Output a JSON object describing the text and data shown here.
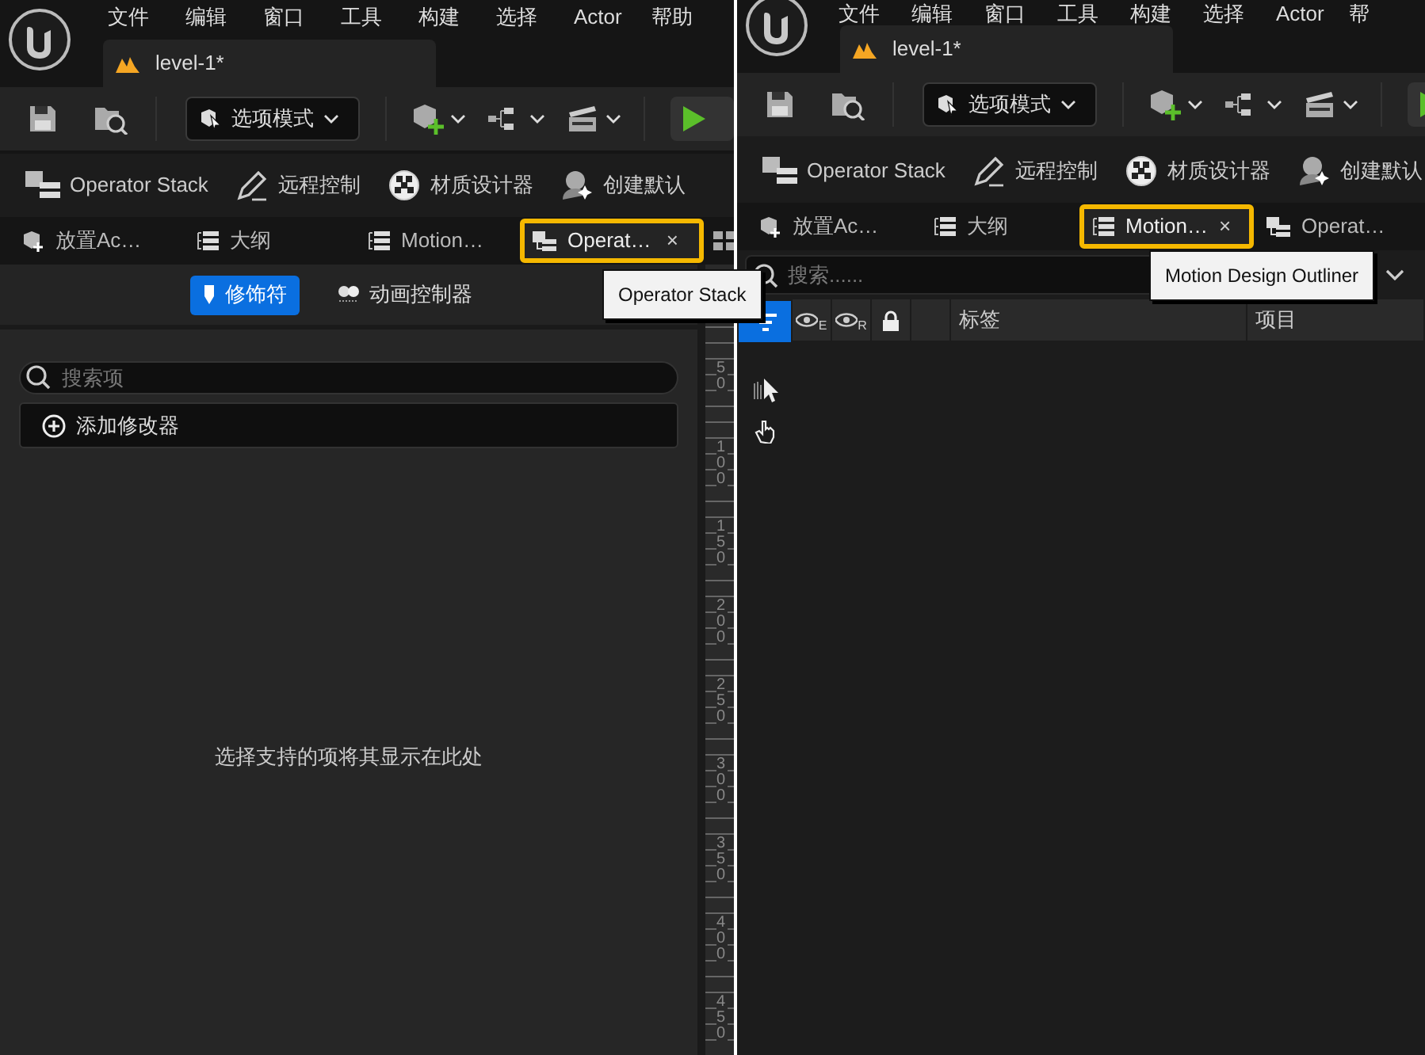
{
  "panels": [
    {
      "menu": [
        "文件",
        "编辑",
        "窗口",
        "工具",
        "构建",
        "选择",
        "Actor",
        "帮助"
      ],
      "level_tab": "level-1*",
      "mode_dropdown": "选项模式",
      "quick_items": [
        "Operator Stack",
        "远程控制",
        "材质设计器",
        "创建默认"
      ],
      "tabs": [
        {
          "label": "放置Ac…",
          "kind": "place",
          "selected": false,
          "highlighted": false
        },
        {
          "label": "大纲",
          "kind": "outline",
          "selected": false,
          "highlighted": false
        },
        {
          "label": "Motion…",
          "kind": "outline",
          "selected": false,
          "highlighted": false
        },
        {
          "label": "Operat…",
          "kind": "stack",
          "selected": true,
          "highlighted": true,
          "close": "×"
        }
      ],
      "tooltip": "Operator Stack",
      "content": {
        "kind": "operator_stack",
        "modes": [
          {
            "label": "修饰符",
            "selected": true
          },
          {
            "label": "动画控制器",
            "selected": false
          }
        ],
        "search_placeholder": "搜索项",
        "add_button": "添加修改器",
        "empty_message": "选择支持的项将其显示在此处",
        "ruler": [
          "50",
          "100",
          "150",
          "200",
          "250",
          "300",
          "350",
          "400",
          "450"
        ]
      }
    },
    {
      "menu": [
        "文件",
        "编辑",
        "窗口",
        "工具",
        "构建",
        "选择",
        "Actor",
        "帮"
      ],
      "level_tab": "level-1*",
      "mode_dropdown": "选项模式",
      "quick_items": [
        "Operator Stack",
        "远程控制",
        "材质设计器",
        "创建默认"
      ],
      "tabs": [
        {
          "label": "放置Ac…",
          "kind": "place",
          "selected": false,
          "highlighted": false
        },
        {
          "label": "大纲",
          "kind": "outline",
          "selected": false,
          "highlighted": false
        },
        {
          "label": "Motion…",
          "kind": "outline",
          "selected": true,
          "highlighted": true,
          "close": "×"
        },
        {
          "label": "Operat…",
          "kind": "stack",
          "selected": false,
          "highlighted": false
        }
      ],
      "tooltip": "Motion Design Outliner",
      "content": {
        "kind": "outliner",
        "search_placeholder": "搜索......",
        "header_icons": [
          {
            "kind": "eye",
            "sub": "E"
          },
          {
            "kind": "eye",
            "sub": "R"
          },
          {
            "kind": "lock"
          },
          {
            "kind": "blank"
          }
        ],
        "columns": [
          "标签",
          "项目"
        ]
      }
    }
  ]
}
